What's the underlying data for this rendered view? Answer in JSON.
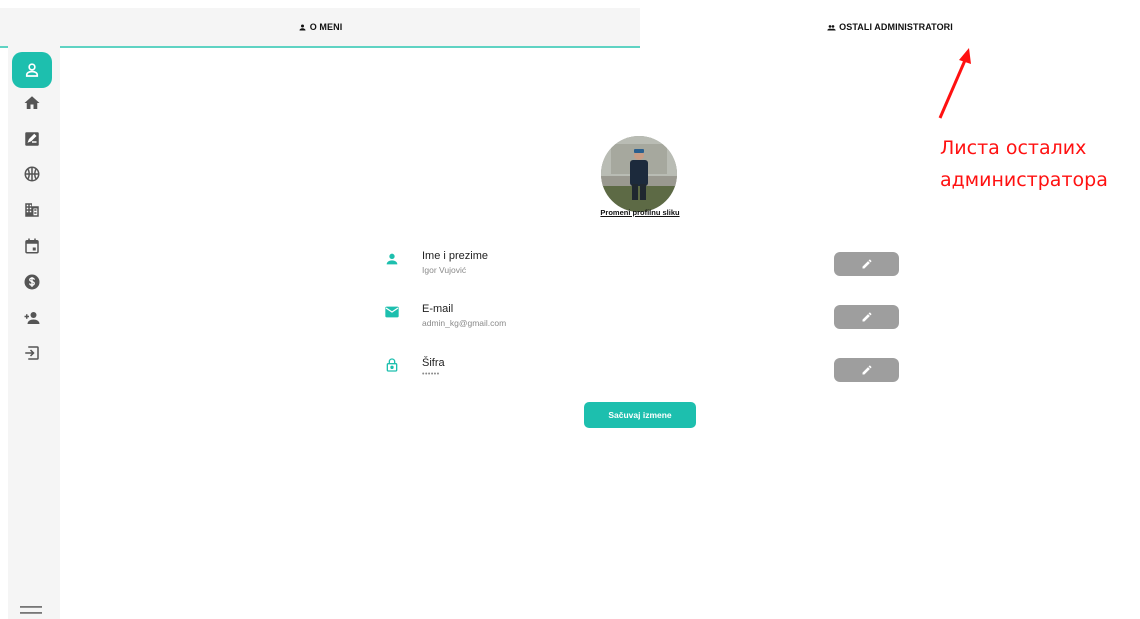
{
  "tabs": [
    {
      "label": "O MENI",
      "icon": "person-icon",
      "active": true
    },
    {
      "label": "OSTALI ADMINISTRATORI",
      "icon": "people-icon",
      "active": false
    }
  ],
  "sidebar": {
    "items": [
      {
        "icon": "profile-icon",
        "active": true
      },
      {
        "icon": "home-icon"
      },
      {
        "icon": "edit-note-icon"
      },
      {
        "icon": "sports-icon"
      },
      {
        "icon": "building-icon"
      },
      {
        "icon": "calendar-icon"
      },
      {
        "icon": "dollar-icon"
      },
      {
        "icon": "add-person-icon"
      },
      {
        "icon": "logout-icon"
      }
    ],
    "bottom_icon": "menu-icon"
  },
  "profile": {
    "change_photo": "Promeni profilnu sliku",
    "fields": [
      {
        "label": "Ime i prezime",
        "value": "Igor Vujović",
        "icon": "person-icon"
      },
      {
        "label": "E-mail",
        "value": "admin_kg@gmail.com",
        "icon": "email-icon"
      },
      {
        "label": "Šifra",
        "value": "••••••",
        "icon": "lock-icon"
      }
    ],
    "edit_icon": "pencil-icon",
    "save_label": "Sačuvaj izmene"
  },
  "annotation": {
    "line1": "Листа осталих",
    "line2": "администратора"
  },
  "colors": {
    "accent": "#1dbfae",
    "edit_button": "#9e9e9e",
    "annotation": "#ff1111",
    "sidebar_bg": "#f5f5f5"
  }
}
